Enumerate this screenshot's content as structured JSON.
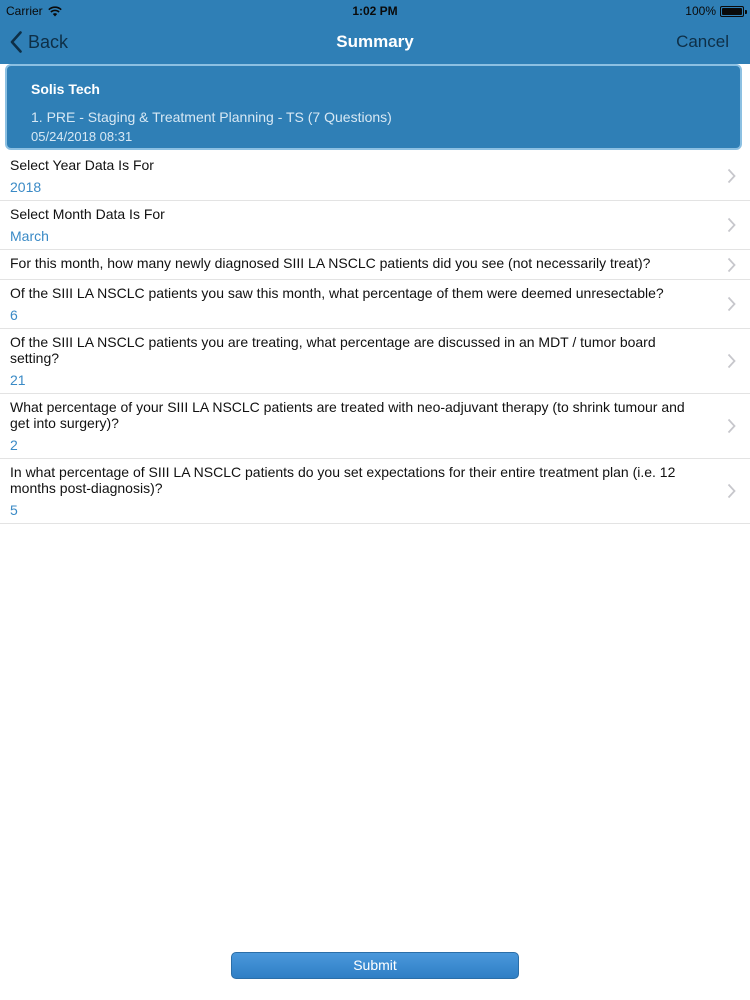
{
  "status_bar": {
    "carrier": "Carrier",
    "time": "1:02 PM",
    "battery": "100%",
    "icons": [
      "wifi-icon",
      "battery-icon"
    ]
  },
  "nav": {
    "back_label": "Back",
    "title": "Summary",
    "cancel_label": "Cancel"
  },
  "card": {
    "company": "Solis Tech",
    "survey": "1. PRE - Staging & Treatment Planning - TS (7 Questions)",
    "date": "05/24/2018 08:31"
  },
  "questions": [
    {
      "question": "Select Year Data Is For",
      "answer": "2018"
    },
    {
      "question": "Select Month Data Is For",
      "answer": "March"
    },
    {
      "question": "For this month, how many newly diagnosed SIII LA NSCLC patients did you see (not necessarily treat)?",
      "answer": ""
    },
    {
      "question": "Of the SIII LA NSCLC patients you saw this month, what percentage of them were deemed unresectable?",
      "answer": "6"
    },
    {
      "question": "Of the SIII LA NSCLC patients you are treating, what percentage are discussed in an MDT / tumor board setting?",
      "answer": "21"
    },
    {
      "question": "What percentage of your SIII LA NSCLC patients are treated with neo-adjuvant therapy (to shrink tumour and get into surgery)?",
      "answer": "2"
    },
    {
      "question": "In what percentage of SIII LA NSCLC patients do you set expectations for their entire treatment plan (i.e. 12 months post-diagnosis)?",
      "answer": "5"
    }
  ],
  "submit_label": "Submit",
  "colors": {
    "nav_background": "#2f7fb6",
    "nav_text": "#0e2f47",
    "answer_text": "#3a8ac6",
    "submit_background": "#3a8ad0"
  }
}
